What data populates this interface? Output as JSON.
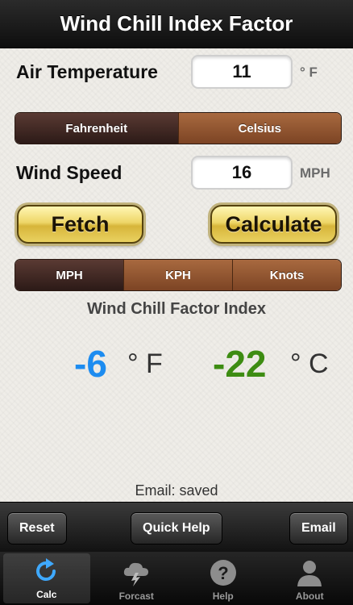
{
  "header": {
    "title": "Wind Chill Index Factor"
  },
  "temperature": {
    "label": "Air Temperature",
    "value": "11",
    "unit": "° F",
    "unit_options": [
      {
        "label": "Fahrenheit",
        "selected": true
      },
      {
        "label": "Celsius",
        "selected": false
      }
    ]
  },
  "wind": {
    "label": "Wind Speed",
    "value": "16",
    "unit": "MPH",
    "unit_options": [
      {
        "label": "MPH",
        "selected": true
      },
      {
        "label": "KPH",
        "selected": false
      },
      {
        "label": "Knots",
        "selected": false
      }
    ]
  },
  "actions": {
    "fetch_label": "Fetch",
    "calculate_label": "Calculate"
  },
  "result": {
    "title": "Wind Chill Factor Index",
    "fahrenheit_value": "-6",
    "fahrenheit_unit": "° F",
    "celsius_value": "-22",
    "celsius_unit": "° C",
    "fahrenheit_color": "#1d8cf0",
    "celsius_color": "#3d8c12"
  },
  "status": {
    "email": "Email: saved"
  },
  "toolbar": {
    "reset_label": "Reset",
    "quick_help_label": "Quick Help",
    "email_label": "Email"
  },
  "tabs": [
    {
      "label": "Calc",
      "icon": "refresh-icon",
      "active": true
    },
    {
      "label": "Forcast",
      "icon": "storm-cloud-icon",
      "active": false
    },
    {
      "label": "Help",
      "icon": "question-icon",
      "active": false
    },
    {
      "label": "About",
      "icon": "person-icon",
      "active": false
    }
  ]
}
